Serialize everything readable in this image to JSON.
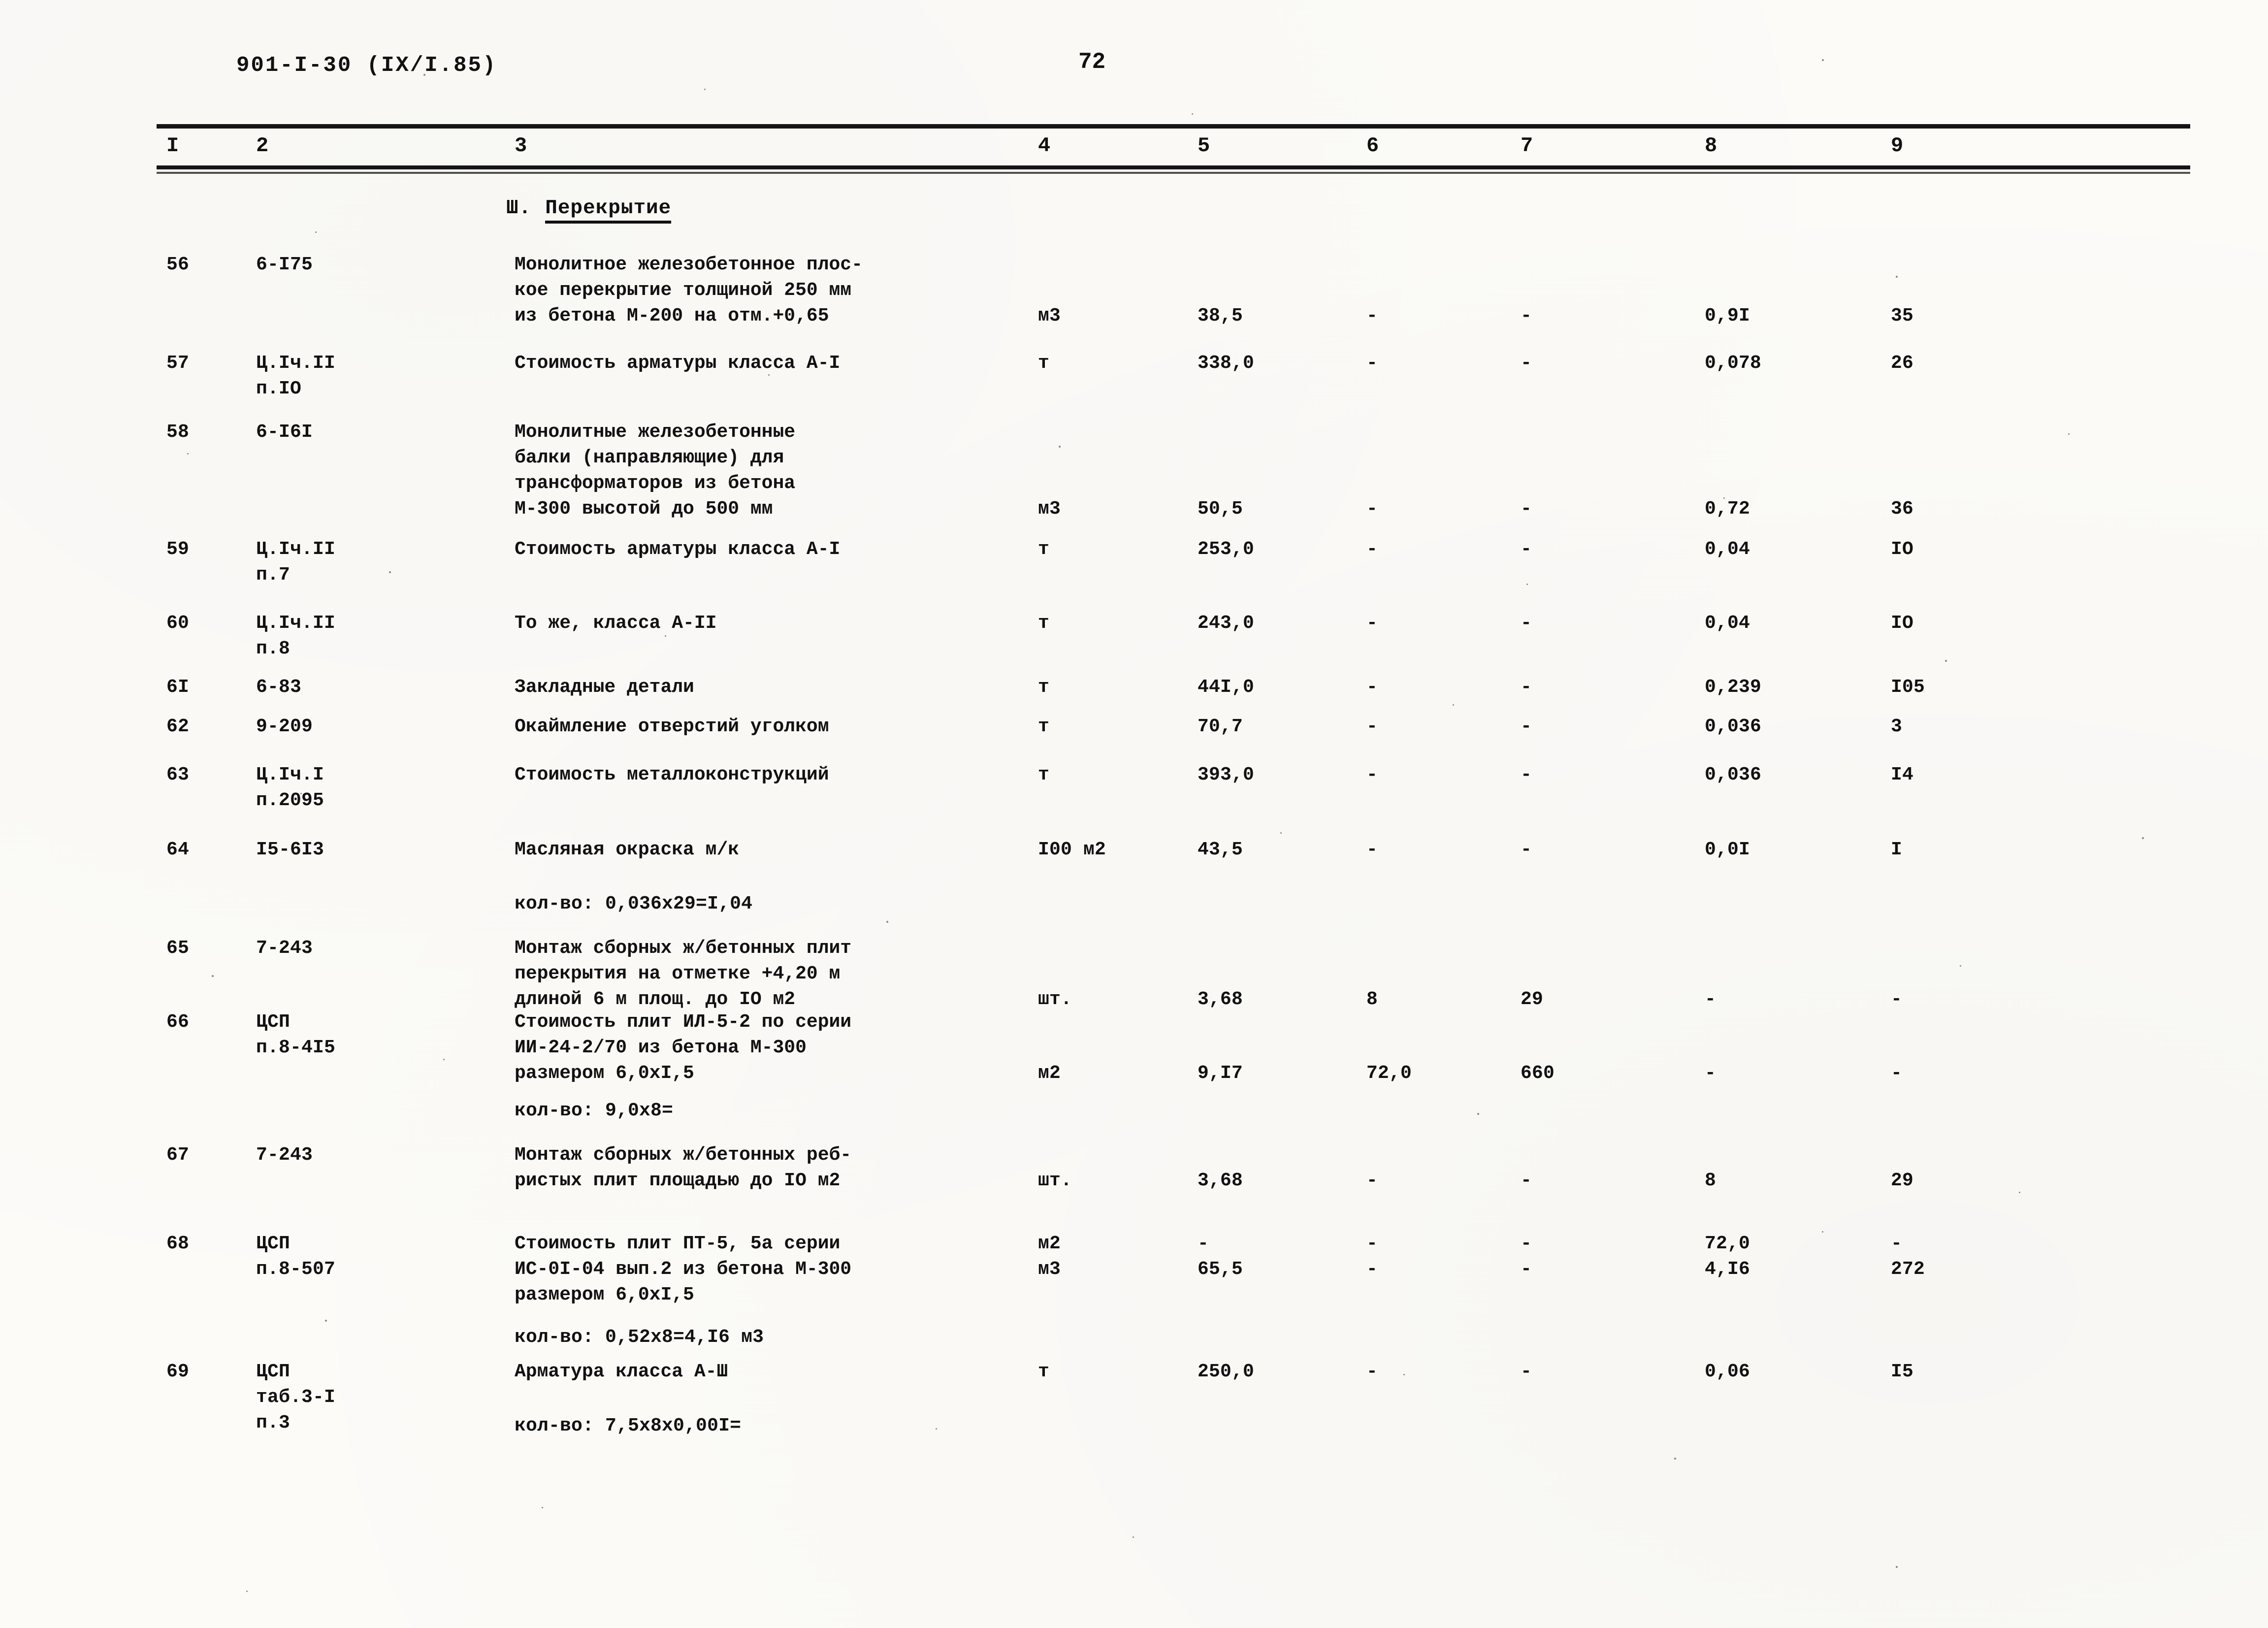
{
  "header": {
    "doc_code": "901-I-30 (IX/I.85)",
    "page_number": "72"
  },
  "table": {
    "column_headers": [
      "I",
      "2",
      "3",
      "4",
      "5",
      "6",
      "7",
      "8",
      "9"
    ],
    "section": {
      "number": "Ш.",
      "title": "Перекрытие"
    },
    "rows": [
      {
        "no": "56",
        "code": "6-I75",
        "desc": "Монолитное железобетонное плос-\nкое перекрытие толщиной 250 мм\nиз бетона М-200 на отм.+0,65",
        "unit": "м3",
        "c5": "38,5",
        "c6": "-",
        "c7": "-",
        "c8": "0,9I",
        "c9": "35"
      },
      {
        "no": "57",
        "code": "Ц.Iч.II\nп.IO",
        "desc": "Стоимость арматуры класса А-I",
        "unit": "т",
        "c5": "338,0",
        "c6": "-",
        "c7": "-",
        "c8": "0,078",
        "c9": "26"
      },
      {
        "no": "58",
        "code": "6-I6I",
        "desc": "Монолитные железобетонные\nбалки (направляющие) для\nтрансформаторов из бетона\nМ-300 высотой до 500 мм",
        "unit": "м3",
        "c5": "50,5",
        "c6": "-",
        "c7": "-",
        "c8": "0,72",
        "c9": "36"
      },
      {
        "no": "59",
        "code": "Ц.Iч.II\nп.7",
        "desc": "Стоимость арматуры класса А-I",
        "unit": "т",
        "c5": "253,0",
        "c6": "-",
        "c7": "-",
        "c8": "0,04",
        "c9": "IO"
      },
      {
        "no": "60",
        "code": "Ц.Iч.II\nп.8",
        "desc": "То же, класса А-II",
        "unit": "т",
        "c5": "243,0",
        "c6": "-",
        "c7": "-",
        "c8": "0,04",
        "c9": "IO"
      },
      {
        "no": "6I",
        "code": "6-83",
        "desc": "Закладные детали",
        "unit": "т",
        "c5": "44I,0",
        "c6": "-",
        "c7": "-",
        "c8": "0,239",
        "c9": "I05"
      },
      {
        "no": "62",
        "code": "9-209",
        "desc": "Окаймление отверстий уголком",
        "unit": "т",
        "c5": "70,7",
        "c6": "-",
        "c7": "-",
        "c8": "0,036",
        "c9": "3"
      },
      {
        "no": "63",
        "code": "Ц.Iч.I\nп.2095",
        "desc": "Стоимость металлоконструкций",
        "unit": "т",
        "c5": "393,0",
        "c6": "-",
        "c7": "-",
        "c8": "0,036",
        "c9": "I4"
      },
      {
        "no": "64",
        "code": "I5-6I3",
        "desc": "Масляная окраска м/к",
        "note": "кол-во: 0,036х29=I,04",
        "unit": "I00 м2",
        "c5": "43,5",
        "c6": "-",
        "c7": "-",
        "c8": "0,0I",
        "c9": "I"
      },
      {
        "no": "65",
        "code": "7-243",
        "desc": "Монтаж сборных ж/бетонных плит\nперекрытия на отметке +4,20 м\nдлиной 6 м площ. до IO м2",
        "unit": "шт.",
        "c5": "3,68",
        "c6": "8",
        "c7": "29",
        "c8": "-",
        "c9": "-"
      },
      {
        "no": "66",
        "code": "ЦСП\nп.8-4I5",
        "desc": "Стоимость плит ИЛ-5-2 по серии\nИИ-24-2/70 из бетона М-300\nразмером 6,0хI,5",
        "note": "кол-во: 9,0х8=",
        "unit": "м2",
        "c5": "9,I7",
        "c6": "72,0",
        "c7": "660",
        "c8": "-",
        "c9": "-"
      },
      {
        "no": "67",
        "code": "7-243",
        "desc": "Монтаж сборных ж/бетонных реб-\nристых плит площадью до IO м2",
        "unit": "шт.",
        "c5": "3,68",
        "c6": "-",
        "c7": "-",
        "c8": "8",
        "c9": "29"
      },
      {
        "no": "68",
        "code": "ЦСП\nп.8-507",
        "desc": "Стоимость плит ПТ-5, 5а серии\nИС-0I-04 вып.2 из бетона М-300\nразмером 6,0хI,5",
        "note": "кол-во: 0,52х8=4,I6 м3",
        "unit": "м2\nм3",
        "c5": "-\n65,5",
        "c6": "-\n-",
        "c7": "-\n-",
        "c8": "72,0\n4,I6",
        "c9": "-\n272"
      },
      {
        "no": "69",
        "code": "ЦСП\nтаб.3-I\nп.3",
        "desc": "Арматура класса А-Ш",
        "note": "кол-во: 7,5х8х0,00I=",
        "unit": "т",
        "c5": "250,0",
        "c6": "-",
        "c7": "-",
        "c8": "0,06",
        "c9": "I5"
      }
    ]
  }
}
